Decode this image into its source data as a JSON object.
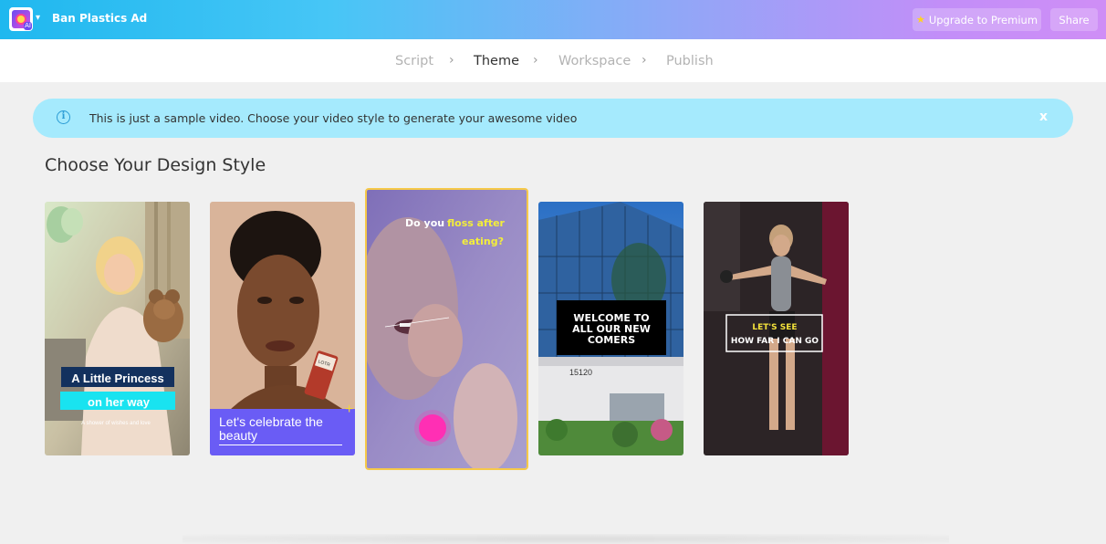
{
  "app": {
    "project_title": "Ban Plastics Ad",
    "logo_badge": "AI",
    "logo_icon": "app-logo-icon",
    "upgrade_label": "Upgrade to Premium",
    "share_label": "Share"
  },
  "steps": [
    {
      "label": "Script",
      "active": false
    },
    {
      "label": "Theme",
      "active": true
    },
    {
      "label": "Workspace",
      "active": false
    },
    {
      "label": "Publish",
      "active": false
    }
  ],
  "banner": {
    "text": "This is just a sample video. Choose your video style to generate your awesome video",
    "close_label": "x"
  },
  "section_title": "Choose Your Design Style",
  "templates": [
    {
      "id": "princess",
      "selected": false,
      "title_line1": "A Little Princess",
      "title_line2": "on her way",
      "subtitle": "A shower of wishes and love"
    },
    {
      "id": "beauty",
      "selected": false,
      "caption": "Let's celebrate the beauty",
      "product_label": "LOTR"
    },
    {
      "id": "floss",
      "selected": true,
      "text_white1": "Do you ",
      "text_yellow1": "floss after",
      "text_yellow2": "eating?"
    },
    {
      "id": "welcome",
      "selected": false,
      "text": "WELCOME TO ALL OUR NEW COMERS",
      "building_number": "15120"
    },
    {
      "id": "fitness",
      "selected": false,
      "text_yellow": "LET'S SEE",
      "text_white": "HOW FAR I CAN GO"
    }
  ],
  "colors": {
    "selected_border": "#f6c949",
    "banner_bg": "#a5eafd",
    "accent_cyan": "#19e3f0",
    "accent_purple": "#6a5cf5",
    "floss_yellow": "#f3ee3b"
  }
}
